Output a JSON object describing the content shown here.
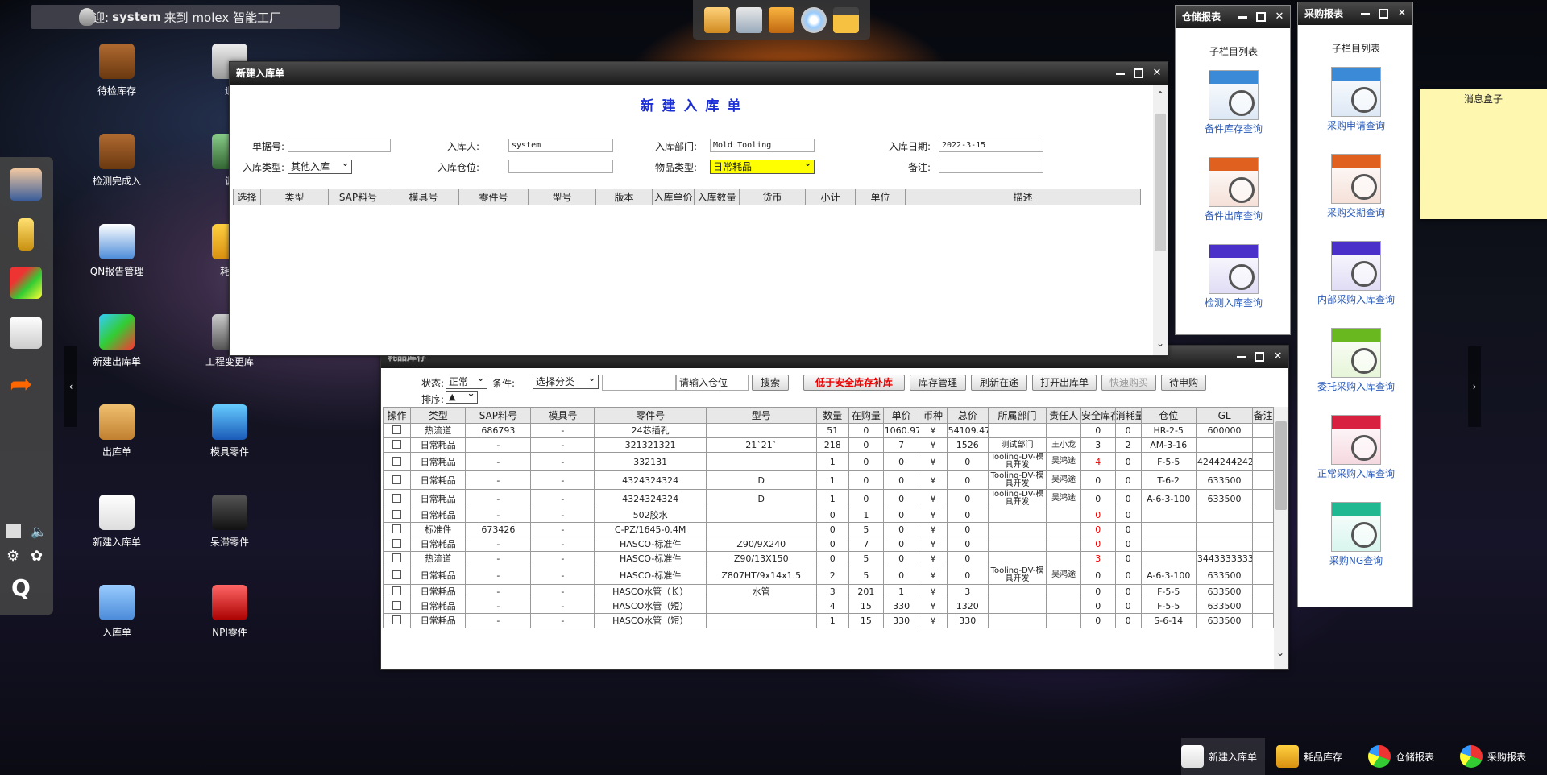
{
  "welcome": {
    "prefix": "欢迎:",
    "user": "system",
    "suffix": "来到 molex 智能工厂"
  },
  "desktop_icons": [
    "待检库存",
    "退",
    "检测完成入",
    "调",
    "QN报告管理",
    "耗品",
    "新建出库单",
    "工程变更库",
    "出库单",
    "模具零件",
    "新建入库单",
    "呆滞零件",
    "入库单",
    "NPI零件"
  ],
  "inbound_window": {
    "title": "新建入库单",
    "heading": "新 建 入 库 单",
    "labels": {
      "doc_no": "单据号:",
      "person": "入库人:",
      "dept": "入库部门:",
      "date": "入库日期:",
      "type": "入库类型:",
      "location": "入库仓位:",
      "item_type": "物品类型:",
      "note": "备注:"
    },
    "values": {
      "doc_no": "",
      "person": "system",
      "dept": "Mold Tooling",
      "date": "2022-3-15",
      "type": "其他入库",
      "location": "",
      "item_type": "日常耗品",
      "note": ""
    },
    "columns": [
      "选择",
      "类型",
      "SAP料号",
      "模具号",
      "零件号",
      "型号",
      "版本",
      "入库单价",
      "入库数量",
      "货币",
      "小计",
      "单位",
      "描述"
    ]
  },
  "consumable_window": {
    "title": "耗品库存",
    "filters": {
      "status_label": "状态:",
      "status_value": "正常",
      "cond_label": "条件:",
      "cond_value": "选择分类",
      "search_value": "",
      "loc_placeholder": "请输入仓位",
      "sort_label": "排序:",
      "sort_value": "▲"
    },
    "buttons": [
      "搜索",
      "低于安全库存补库",
      "库存管理",
      "刷新在途",
      "打开出库单",
      "快速购买",
      "待申购"
    ],
    "columns": [
      "操作",
      "类型",
      "SAP料号",
      "模具号",
      "零件号",
      "型号",
      "数量",
      "在购量",
      "单价",
      "币种",
      "总价",
      "所属部门",
      "责任人",
      "安全库存",
      "消耗量",
      "仓位",
      "GL",
      "备注"
    ],
    "rows": [
      [
        "热流道",
        "686793",
        "-",
        "24芯插孔",
        "",
        "51",
        "0",
        "1060.97",
        "¥",
        "54109.47",
        "",
        "",
        "0",
        "0",
        "HR-2-5",
        "600000",
        ""
      ],
      [
        "日常耗品",
        "-",
        "-",
        "321321321",
        "21`21`",
        "218",
        "0",
        "7",
        "¥",
        "1526",
        "测试部门",
        "王小龙",
        "3",
        "2",
        "AM-3-16",
        "",
        ""
      ],
      [
        "日常耗品",
        "-",
        "-",
        "332131",
        "",
        "1",
        "0",
        "0",
        "¥",
        "0",
        "Tooling-DV-模具开发",
        "吴鸿途",
        "4",
        "0",
        "F-5-5",
        "4244244242",
        ""
      ],
      [
        "日常耗品",
        "-",
        "-",
        "4324324324",
        "D",
        "1",
        "0",
        "0",
        "¥",
        "0",
        "Tooling-DV-模具开发",
        "吴鸿途",
        "0",
        "0",
        "T-6-2",
        "633500",
        ""
      ],
      [
        "日常耗品",
        "-",
        "-",
        "4324324324",
        "D",
        "1",
        "0",
        "0",
        "¥",
        "0",
        "Tooling-DV-模具开发",
        "吴鸿途",
        "0",
        "0",
        "A-6-3-100",
        "633500",
        ""
      ],
      [
        "日常耗品",
        "-",
        "-",
        "502胶水",
        "",
        "0",
        "1",
        "0",
        "¥",
        "0",
        "",
        "",
        "0",
        "0",
        "",
        "",
        ""
      ],
      [
        "标准件",
        "673426",
        "-",
        "C-PZ/1645-0.4M",
        "",
        "0",
        "5",
        "0",
        "¥",
        "0",
        "",
        "",
        "0",
        "0",
        "",
        "",
        ""
      ],
      [
        "日常耗品",
        "-",
        "-",
        "HASCO-标准件",
        "Z90/9X240",
        "0",
        "7",
        "0",
        "¥",
        "0",
        "",
        "",
        "0",
        "0",
        "",
        "",
        ""
      ],
      [
        "热流道",
        "-",
        "-",
        "HASCO-标准件",
        "Z90/13X150",
        "0",
        "5",
        "0",
        "¥",
        "0",
        "",
        "",
        "3",
        "0",
        "",
        "3443333333",
        ""
      ],
      [
        "日常耗品",
        "-",
        "-",
        "HASCO-标准件",
        "Z807HT/9x14x1.5",
        "2",
        "5",
        "0",
        "¥",
        "0",
        "Tooling-DV-模具开发",
        "吴鸿途",
        "0",
        "0",
        "A-6-3-100",
        "633500",
        ""
      ],
      [
        "日常耗品",
        "-",
        "-",
        "HASCO水管（长）",
        "水管",
        "3",
        "201",
        "1",
        "¥",
        "3",
        "",
        "",
        "0",
        "0",
        "F-5-5",
        "633500",
        ""
      ],
      [
        "日常耗品",
        "-",
        "-",
        "HASCO水管（短）",
        "",
        "4",
        "15",
        "330",
        "¥",
        "1320",
        "",
        "",
        "0",
        "0",
        "F-5-5",
        "633500",
        ""
      ],
      [
        "日常耗品",
        "-",
        "-",
        "HASCO水管（短）",
        "",
        "1",
        "15",
        "330",
        "¥",
        "330",
        "",
        "",
        "0",
        "0",
        "S-6-14",
        "633500",
        ""
      ]
    ],
    "red_safety_rows": [
      2,
      5,
      6,
      7,
      8
    ]
  },
  "warehouse_report": {
    "title": "仓储报表",
    "subtitle": "子栏目列表",
    "items": [
      "备件库存查询",
      "备件出库查询",
      "检测入库查询"
    ]
  },
  "purchase_report": {
    "title": "采购报表",
    "subtitle": "子栏目列表",
    "items": [
      "采购申请查询",
      "采购交期查询",
      "内部采购入库查询",
      "委托采购入库查询",
      "正常采购入库查询",
      "采购NG查询"
    ]
  },
  "sticky": {
    "title": "消息盒子"
  },
  "taskbar": [
    "新建入库单",
    "耗品库存",
    "仓储报表",
    "采购报表"
  ],
  "colors": {
    "title_blue": "#1a2fd6",
    "highlight_yellow": "#ffff00",
    "warn_red": "#e00000"
  }
}
